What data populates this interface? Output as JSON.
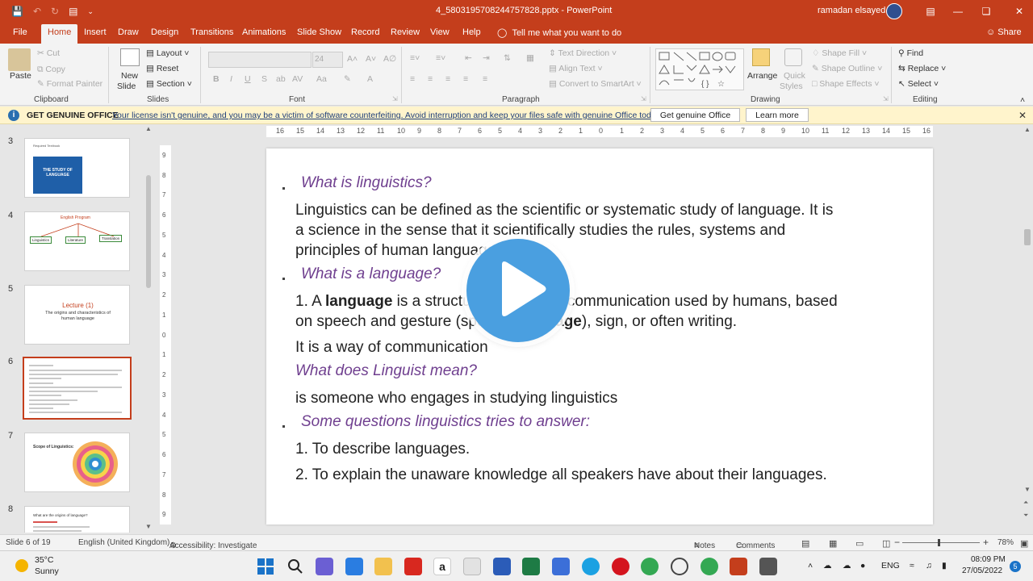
{
  "titlebar": {
    "title": "4_5803195708244757828.pptx  -  PowerPoint",
    "user": "ramadan elsayed"
  },
  "tabs": [
    "File",
    "Home",
    "Insert",
    "Draw",
    "Design",
    "Transitions",
    "Animations",
    "Slide Show",
    "Record",
    "Review",
    "View",
    "Help"
  ],
  "tell_me": "Tell me what you want to do",
  "share": "Share",
  "ribbon": {
    "clipboard": {
      "label": "Clipboard",
      "paste": "Paste",
      "cut": "Cut",
      "copy": "Copy",
      "format_painter": "Format Painter"
    },
    "slides": {
      "label": "Slides",
      "new_slide_1": "New",
      "new_slide_2": "Slide",
      "layout": "Layout",
      "reset": "Reset",
      "section": "Section"
    },
    "font": {
      "label": "Font",
      "size": "24"
    },
    "paragraph": {
      "label": "Paragraph",
      "text_direction": "Text Direction",
      "align_text": "Align Text",
      "smartart": "Convert to SmartArt"
    },
    "drawing": {
      "label": "Drawing",
      "arrange": "Arrange",
      "quick_styles_1": "Quick",
      "quick_styles_2": "Styles",
      "shape_fill": "Shape Fill",
      "shape_outline": "Shape Outline",
      "shape_effects": "Shape Effects"
    },
    "editing": {
      "label": "Editing",
      "find": "Find",
      "replace": "Replace",
      "select": "Select"
    }
  },
  "message_bar": {
    "heading": "GET GENUINE OFFICE",
    "text": "Your license isn't genuine, and you may be a victim of software counterfeiting. Avoid interruption and keep your files safe with genuine Office today.",
    "button_get": "Get genuine Office",
    "button_learn": "Learn more"
  },
  "thumbnails": [
    {
      "num": "3",
      "title": "Required Textbook",
      "caption": "THE STUDY OF LANGUAGE"
    },
    {
      "num": "4",
      "title": "English Program",
      "boxes": [
        "Linguistics",
        "Literature",
        "Translation"
      ]
    },
    {
      "num": "5",
      "title": "Lecture (1)",
      "caption": "The origins and characteristics of human language"
    },
    {
      "num": "6"
    },
    {
      "num": "7",
      "title": "Scope of Linguistics:"
    },
    {
      "num": "8",
      "title": "What are the origins of language?"
    }
  ],
  "ruler_h": [
    "16",
    "15",
    "14",
    "13",
    "12",
    "11",
    "10",
    "9",
    "8",
    "7",
    "6",
    "5",
    "4",
    "3",
    "2",
    "1",
    "0",
    "1",
    "2",
    "3",
    "4",
    "5",
    "6",
    "7",
    "8",
    "9",
    "10",
    "11",
    "12",
    "13",
    "14",
    "15",
    "16"
  ],
  "ruler_v": [
    "9",
    "8",
    "7",
    "6",
    "5",
    "4",
    "3",
    "2",
    "1",
    "0",
    "1",
    "2",
    "3",
    "4",
    "5",
    "6",
    "7",
    "8",
    "9"
  ],
  "slide": {
    "h1": "What is linguistics?",
    "p1_l1": "Linguistics can be defined as the scientific or systematic study of language. It is",
    "p1_l2": "a science in the sense that it scientifically studies the rules, systems and",
    "p1_l3": "principles of human language.",
    "h2": "What is a language?",
    "p2_l1a": "1.  A ",
    "p2_l1b": "language",
    "p2_l1c": " is a structured system of communication used by humans, based",
    "p2_l2a": "on speech and gesture (spoken ",
    "p2_l2b": "language",
    "p2_l2c": "), sign, or often writing.",
    "p3": "It is a way of communication",
    "h3": "What does Linguist mean?",
    "p4": "is someone who engages in studying linguistics",
    "h4": "Some questions linguistics tries to answer:",
    "p5": "1. To describe languages.",
    "p6": "2. To explain the unaware knowledge all speakers have about their languages."
  },
  "statusbar": {
    "slide": "Slide 6 of 19",
    "lang": "English (United Kingdom)",
    "access": "Accessibility: Investigate",
    "notes": "Notes",
    "comments": "Comments",
    "zoom": "78%"
  },
  "taskbar": {
    "temp": "35°C",
    "condition": "Sunny",
    "lang": "ENG",
    "time": "08:09 PM",
    "date": "27/05/2022",
    "notifications": "5"
  },
  "colors": {
    "brand": "#c43e1c",
    "heading": "#6f3f8f",
    "play": "#4a9fe0"
  }
}
